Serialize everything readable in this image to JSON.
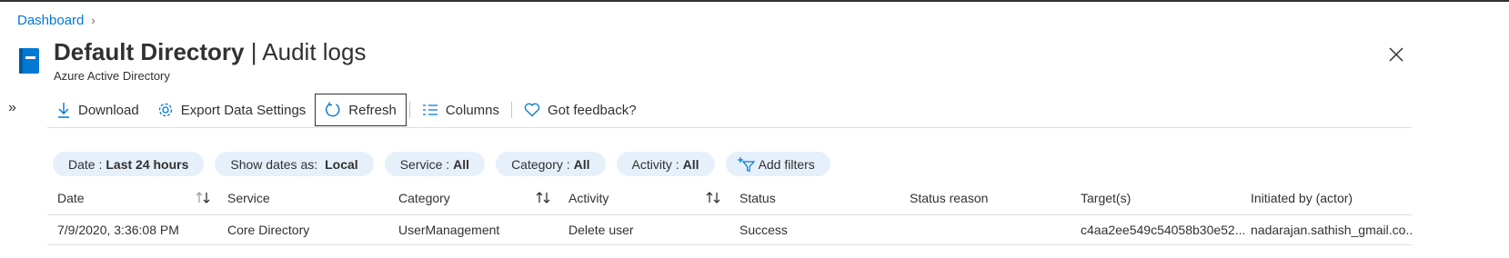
{
  "breadcrumb": {
    "items": [
      {
        "label": "Dashboard"
      }
    ]
  },
  "header": {
    "title_bold": "Default Directory",
    "title_sep": "|",
    "title_rest": "Audit logs",
    "subtitle": "Azure Active Directory"
  },
  "toolbar": {
    "download": "Download",
    "export": "Export Data Settings",
    "refresh": "Refresh",
    "columns": "Columns",
    "feedback": "Got feedback?"
  },
  "filters": {
    "date": {
      "label": "Date :",
      "value": "Last 24 hours"
    },
    "show_dates": {
      "label": "Show dates as:",
      "value": "Local"
    },
    "service": {
      "label": "Service :",
      "value": "All"
    },
    "category": {
      "label": "Category :",
      "value": "All"
    },
    "activity": {
      "label": "Activity :",
      "value": "All"
    },
    "add": "Add filters"
  },
  "table": {
    "columns": [
      "Date",
      "Service",
      "Category",
      "Activity",
      "Status",
      "Status reason",
      "Target(s)",
      "Initiated by (actor)"
    ],
    "rows": [
      [
        "7/9/2020, 3:36:08 PM",
        "Core Directory",
        "UserManagement",
        "Delete user",
        "Success",
        "",
        "c4aa2ee549c54058b30e52...",
        "nadarajan.sathish_gmail.co..."
      ]
    ]
  },
  "colors": {
    "accent": "#0078d4",
    "pill_bg": "#e6f0fb",
    "text": "#323130"
  }
}
